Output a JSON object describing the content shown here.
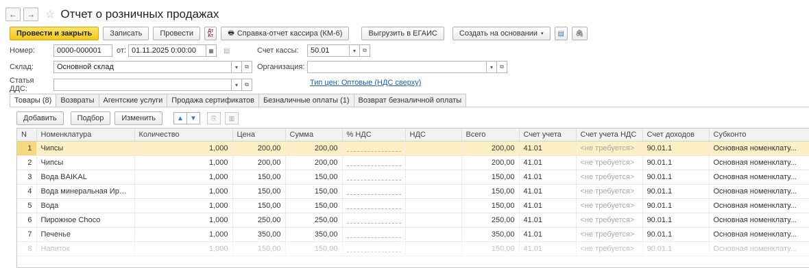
{
  "window": {
    "title": "Отчет о розничных продажах"
  },
  "toolbar": {
    "post_close": "Провести и закрыть",
    "write": "Записать",
    "post": "Провести",
    "dt_kt": "Дт Кт",
    "cashier_report": "Справка-отчет кассира (КМ-6)",
    "egais": "Выгрузить в ЕГАИС",
    "create_based": "Создать на основании"
  },
  "form": {
    "number_label": "Номер:",
    "number_value": "0000-000001",
    "date_label": "от:",
    "date_value": "01.11.2025  0:00:00",
    "cash_label": "Счет кассы:",
    "cash_value": "50.01",
    "warehouse_label": "Склад:",
    "warehouse_value": "Основной склад",
    "org_label": "Организация:",
    "org_value": "",
    "dds_label": "Статья ДДС:",
    "dds_value": "",
    "price_type_link": "Тип цен: Оптовые (НДС сверху)"
  },
  "tabs": [
    "Товары (8)",
    "Возвраты",
    "Агентские услуги",
    "Продажа сертификатов",
    "Безналичные оплаты (1)",
    "Возврат безналичной оплаты"
  ],
  "table_toolbar": {
    "add": "Добавить",
    "select": "Подбор",
    "change": "Изменить"
  },
  "table": {
    "headers": [
      "N",
      "Номенклатура",
      "Количество",
      "Цена",
      "Сумма",
      "% НДС",
      "НДС",
      "Всего",
      "Счет учета",
      "Счет учета НДС",
      "Счет доходов",
      "Субконто"
    ],
    "rows": [
      [
        "1",
        "Чипсы",
        "1,000",
        "200,00",
        "200,00",
        "",
        "",
        "200,00",
        "41.01",
        "<не требуется>",
        "90.01.1",
        "Основная номенклату..."
      ],
      [
        "2",
        "Чипсы",
        "1,000",
        "200,00",
        "200,00",
        "",
        "",
        "200,00",
        "41.01",
        "<не требуется>",
        "90.01.1",
        "Основная номенклату..."
      ],
      [
        "3",
        "Вода BAIKAL",
        "1,000",
        "150,00",
        "150,00",
        "",
        "",
        "150,00",
        "41.01",
        "<не требуется>",
        "90.01.1",
        "Основная номенклату..."
      ],
      [
        "4",
        "Вода минеральная Иркутская (...",
        "1,000",
        "150,00",
        "150,00",
        "",
        "",
        "150,00",
        "41.01",
        "<не требуется>",
        "90.01.1",
        "Основная номенклату..."
      ],
      [
        "5",
        "Вода",
        "1,000",
        "150,00",
        "150,00",
        "",
        "",
        "150,00",
        "41.01",
        "<не требуется>",
        "90.01.1",
        "Основная номенклату..."
      ],
      [
        "6",
        "Пирожное Choco",
        "1,000",
        "250,00",
        "250,00",
        "",
        "",
        "250,00",
        "41.01",
        "<не требуется>",
        "90.01.1",
        "Основная номенклату..."
      ],
      [
        "7",
        "Печенье",
        "1,000",
        "350,00",
        "350,00",
        "",
        "",
        "350,00",
        "41.01",
        "<не требуется>",
        "90.01.1",
        "Основная номенклату..."
      ],
      [
        "8",
        "Напиток",
        "1,000",
        "150,00",
        "150,00",
        "",
        "",
        "150,00",
        "41.01",
        "<не требуется>",
        "90.01.1",
        "Основная номенклату..."
      ]
    ]
  }
}
